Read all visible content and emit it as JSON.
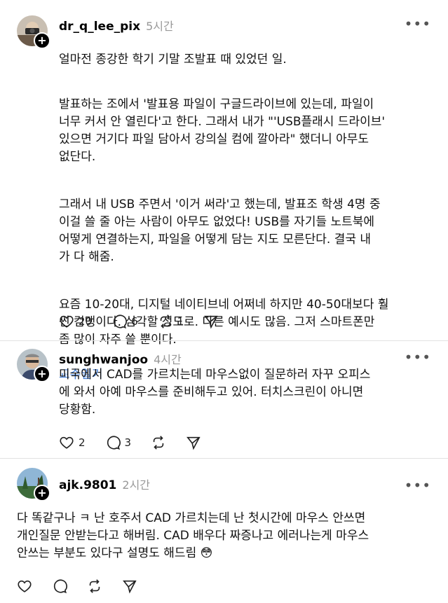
{
  "posts": [
    {
      "username": "dr_q_lee_pix",
      "time": "5시간",
      "body": [
        "얼마전 종강한 학기 기말 조발표 때 있었던 일."
      ],
      "paragraphs": [
        "발표하는 조에서 '발표용 파일이 구글드라이브에 있는데, 파일이\n너무 커서 안 열린다'고 한다. 그래서 내가 \"'USB플래시 드라이브'\n있으면 거기다 파일 담아서 강의실 컴에 깔아라\" 했더니 아무도\n없단다.",
        "그래서 내 USB 주면서 '이거 써라'고 했는데, 발표조 학생 4명 중\n이걸 쓸 줄 아는 사람이 아무도 없었다! USB를 자기들 노트북에\n어떻게 연결하는지, 파일을 어떻게 담는 지도 모른단다. 결국 내\n가 다 해줌.",
        "요즘 10-20대, 디지털 네이티브네 어쩌네 하지만 40-50대보다 훨\n씬 컴맹이다. 심각할 정도로. 다른 예시도 많음. 그저 스마트폰만\n좀 많이 자주 쓸 뿐이다."
      ],
      "tag": "교수일기",
      "likes": "20",
      "comments": "6",
      "reposts": "1"
    },
    {
      "username": "sunghwanjoo",
      "time": "4시간",
      "body": "미국에서 CAD를 가르치는데 마우스없이 질문하러 자꾸 오피스\n에 와서 아예 마우스를 준비해두고 있어. 터치스크린이 아니면\n당황함.",
      "likes": "2",
      "comments": "3"
    },
    {
      "username": "ajk.9801",
      "time": "2시간",
      "body": "다 똑같구나 ㅋ 난 호주서 CAD 가르치는데 난 첫시간에 마우스 안쓰면\n개인질문 안받는다고 해버림. CAD 배우다 짜증나고 에러나는게 마우스\n안쓰는 부분도 있다구 설명도 해드림",
      "emoji": "😳"
    }
  ],
  "icons": {
    "like": "heart-icon",
    "comment": "comment-icon",
    "repost": "repost-icon",
    "share": "send-icon",
    "more": "more-dots-icon",
    "follow": "plus-icon"
  },
  "colors": {
    "tag": "#3e7bd6",
    "muted": "#999999",
    "divider": "#e2e2e2"
  }
}
